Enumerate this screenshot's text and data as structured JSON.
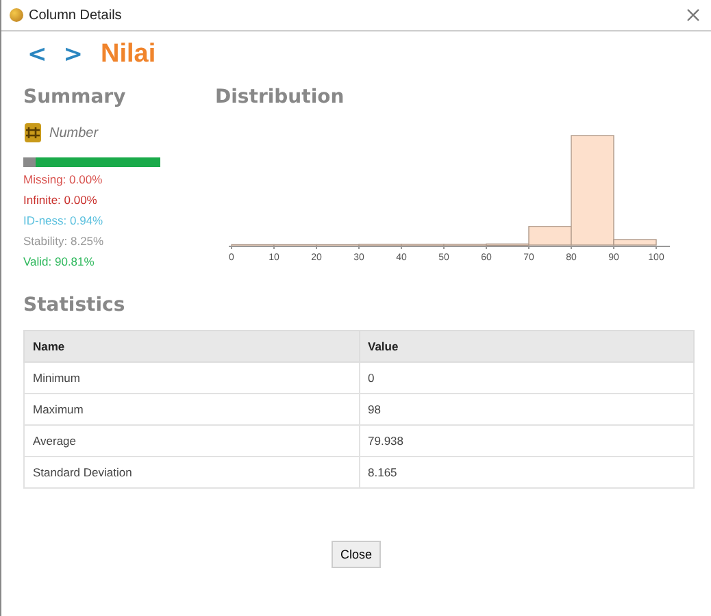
{
  "window": {
    "title": "Column Details"
  },
  "header": {
    "prev": "<",
    "next": ">",
    "title": "Nilai"
  },
  "summary": {
    "heading": "Summary",
    "type": "Number",
    "quality_bar": {
      "level": 0.9081
    },
    "stats": [
      {
        "text": "Missing: 0.00%",
        "color": "#d9534f"
      },
      {
        "text": "Infinite: 0.00%",
        "color": "#c9302c"
      },
      {
        "text": "ID-ness: 0.94%",
        "color": "#5bc0de"
      },
      {
        "text": "Stability: 8.25%",
        "color": "#999999"
      },
      {
        "text": "Valid: 90.81%",
        "color": "#2eb85c"
      }
    ]
  },
  "distribution": {
    "heading": "Distribution",
    "xticks": [
      "0",
      "10",
      "20",
      "30",
      "40",
      "50",
      "60",
      "70",
      "80",
      "90",
      "100"
    ]
  },
  "statistics": {
    "heading": "Statistics",
    "columns": [
      "Name",
      "Value"
    ],
    "rows": [
      [
        "Minimum",
        "0"
      ],
      [
        "Maximum",
        "98"
      ],
      [
        "Average",
        "79.938"
      ],
      [
        "Standard Deviation",
        "8.165"
      ]
    ]
  },
  "buttons": [
    "Close"
  ]
}
